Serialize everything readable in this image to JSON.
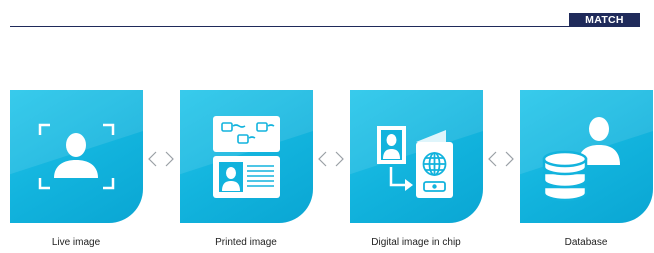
{
  "header": {
    "badge": "MATCH"
  },
  "steps": [
    {
      "label": "Live image",
      "icon": "face-scan-icon"
    },
    {
      "label": "Printed image",
      "icon": "printed-id-card-icon"
    },
    {
      "label": "Digital image in chip",
      "icon": "passport-chip-icon"
    },
    {
      "label": "Database",
      "icon": "database-user-icon"
    }
  ],
  "separator_icon": "compare-arrows-icon",
  "colors": {
    "tile": "#12b3dd",
    "navy": "#1f2a5a"
  }
}
